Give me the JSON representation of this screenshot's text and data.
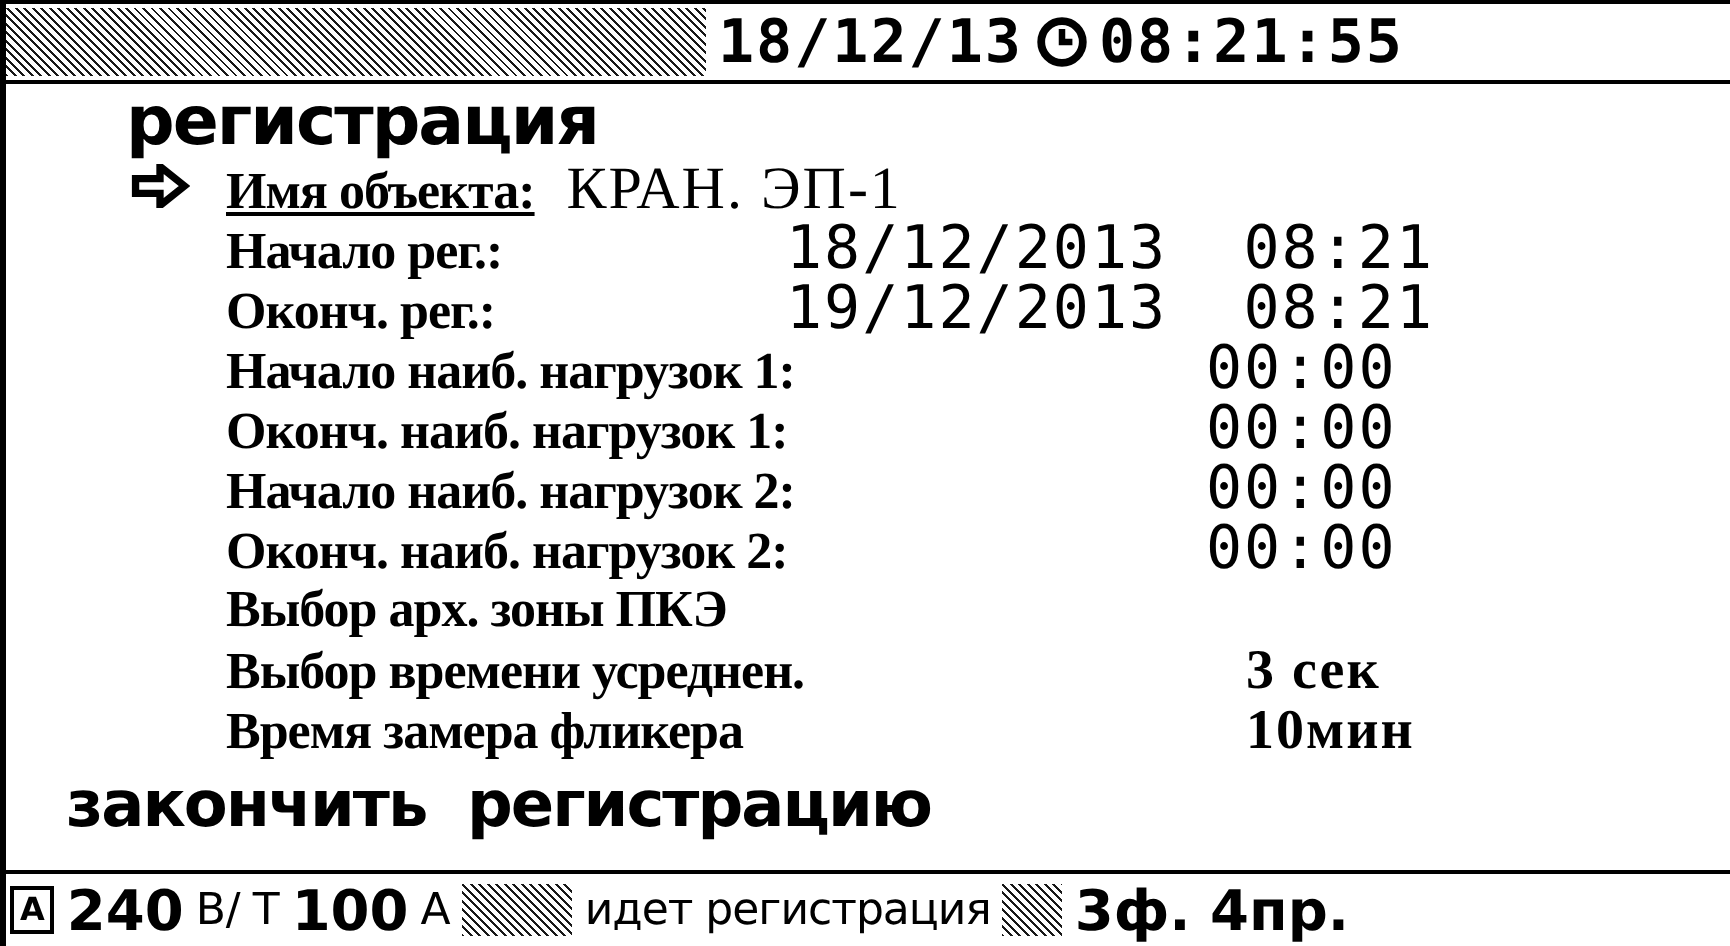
{
  "header": {
    "date": "18/12/13",
    "time": "08:21:55"
  },
  "title": "регистрация",
  "items": [
    {
      "kind": "name",
      "label": "Имя объекта:",
      "value": "КРАН. ЭП-1",
      "selected": true
    },
    {
      "kind": "date",
      "label": "Начало рег.:",
      "value": "18/12/2013  08:21",
      "selected": false
    },
    {
      "kind": "date",
      "label": "Оконч. рег.:",
      "value": "19/12/2013  08:21",
      "selected": false
    },
    {
      "kind": "time",
      "label": "Начало наиб. нагрузок 1:",
      "value": "00:00",
      "selected": false
    },
    {
      "kind": "time",
      "label": "Оконч. наиб. нагрузок 1:",
      "value": "00:00",
      "selected": false
    },
    {
      "kind": "time",
      "label": "Начало наиб. нагрузок 2:",
      "value": "00:00",
      "selected": false
    },
    {
      "kind": "time",
      "label": "Оконч. наиб. нагрузок 2:",
      "value": "00:00",
      "selected": false
    },
    {
      "kind": "setting",
      "label": "Выбор арх. зоны ПКЭ",
      "selected": false
    },
    {
      "kind": "setting",
      "label": "Выбор времени усреднен.",
      "value": "3 сек",
      "selected": false
    },
    {
      "kind": "setting",
      "label": "Время замера фликера",
      "value": "10мин",
      "selected": false
    }
  ],
  "action": "закончить  регистрацию",
  "status_bar": {
    "mode": "A",
    "voltage": "240",
    "voltage_unit": "В/",
    "ct_label": "Т",
    "current": "100",
    "current_unit": "А",
    "message": "идет регистрация",
    "scheme": "3ф. 4пр."
  }
}
